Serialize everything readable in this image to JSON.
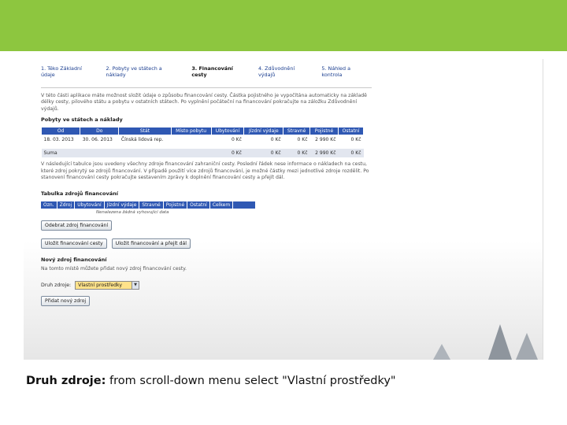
{
  "steps": [
    "1. Téko Základní údaje",
    "2. Pobyty ve státech a náklady",
    "3. Financování cesty",
    "4. Zdůvodnění výdajů",
    "5. Náhled a kontrola"
  ],
  "intro_text": "V této části aplikace máte možnost složit údaje o způsobu financování cesty. Částka pojistného je vypočítána automaticky na základě délky cesty, pilového státu a pobytu v ostatních státech. Po vyplnění počáteční na financování pokračujte na záložku Zdůvodnění výdajů.",
  "stays": {
    "heading": "Pobyty ve státech a náklady",
    "columns": [
      "Od",
      "Do",
      "Stát",
      "Místo pobytu",
      "Ubytování",
      "Jízdní výdaje",
      "Stravné",
      "Pojistné",
      "Ostatní"
    ],
    "rows": [
      [
        "18. 03. 2013",
        "30. 06. 2013",
        "Čínská lidová rep.",
        "",
        "0 Kč",
        "0 Kč",
        "0 Kč",
        "2 990 Kč",
        "0 Kč"
      ]
    ],
    "sum": [
      "Suma",
      "",
      "",
      "",
      "0 Kč",
      "0 Kč",
      "0 Kč",
      "2 990 Kč",
      "0 Kč"
    ]
  },
  "explain_text": "V následující tabulce jsou uvedeny všechny zdroje financování zahraniční cesty. Poslední řádek nese informace o nákladech na cestu, které zdroj pokrytý se zdrojů financování. V případě použití více zdrojů financování, je možné částky mezi jednotlivé zdroje rozdělit. Po stanovení financování cesty pokračujte sestavením zprávy k doplnění financování cesty a přejít dál.",
  "sources": {
    "heading": "Tabulka zdrojů financování",
    "columns": [
      "Ozn.",
      "Zdroj",
      "Ubytování",
      "Jízdní výdaje",
      "Stravné",
      "Pojistné",
      "Ostatní",
      "Celkem"
    ],
    "empty_note": "Nenalezena žádná vyhovující data"
  },
  "buttons": {
    "remove_source": "Odebrat zdroj financování",
    "save": "Uložit financování cesty",
    "save_next": "Uložit financování a přejít dál",
    "add_source": "Přidat nový zdroj"
  },
  "new_source": {
    "heading": "Nový zdroj financování",
    "note": "Na tomto místě můžete přidat nový zdroj financování cesty.",
    "field_label": "Druh zdroje:",
    "selected": "Vlastní prostředky"
  },
  "caption": {
    "bold": "Druh zdroje:",
    "rest": " from scroll-down menu select \"Vlastní prostředky\""
  },
  "colors": {
    "band": "#8dc63f",
    "header": "#2f58b3",
    "select": "#ffe28a"
  }
}
